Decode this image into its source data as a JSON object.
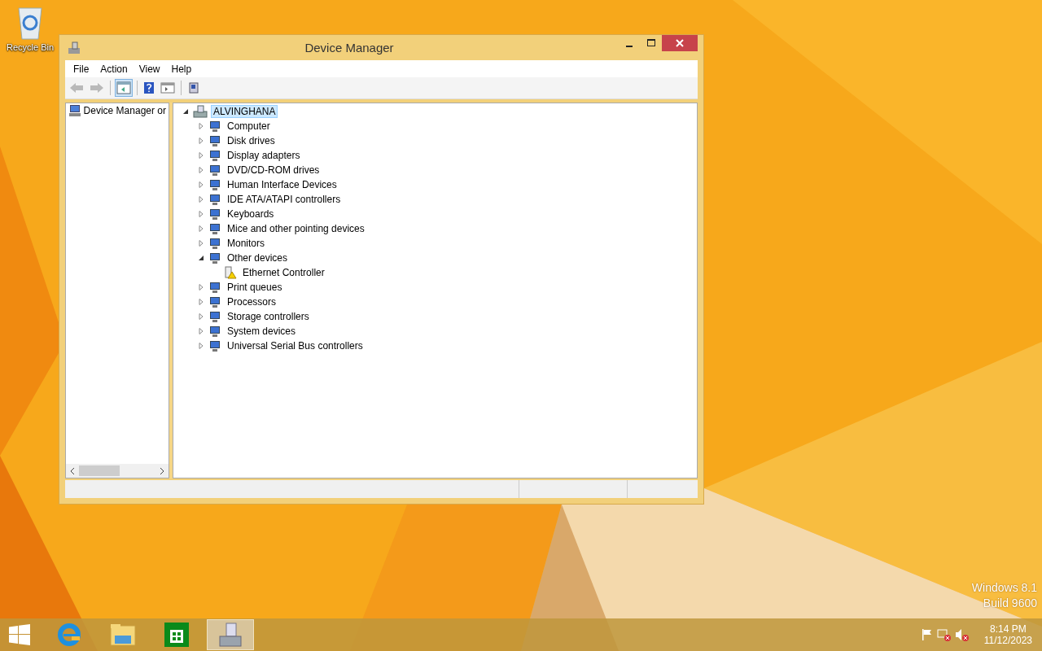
{
  "desktop": {
    "icons": [
      {
        "label": "Recycle Bin"
      }
    ],
    "watermark": [
      "Windows 8.1",
      "Build 9600"
    ]
  },
  "window": {
    "title": "Device Manager"
  },
  "menu": [
    "File",
    "Action",
    "View",
    "Help"
  ],
  "toolbar": [
    {
      "kind": "back",
      "disabled": true
    },
    {
      "kind": "forward",
      "disabled": true
    },
    {
      "kind": "sep"
    },
    {
      "kind": "tree",
      "selected": true
    },
    {
      "kind": "sep"
    },
    {
      "kind": "help",
      "selected": false
    },
    {
      "kind": "pane",
      "selected": false
    },
    {
      "kind": "sep"
    },
    {
      "kind": "scan",
      "selected": false
    }
  ],
  "left_pane": {
    "item": "Device Manager or"
  },
  "tree": {
    "label": "ALVINGHANA",
    "expanded": true,
    "selected": true,
    "children": [
      {
        "label": "Computer",
        "expanded": false
      },
      {
        "label": "Disk drives",
        "expanded": false
      },
      {
        "label": "Display adapters",
        "expanded": false
      },
      {
        "label": "DVD/CD-ROM drives",
        "expanded": false
      },
      {
        "label": "Human Interface Devices",
        "expanded": false
      },
      {
        "label": "IDE ATA/ATAPI controllers",
        "expanded": false
      },
      {
        "label": "Keyboards",
        "expanded": false
      },
      {
        "label": "Mice and other pointing devices",
        "expanded": false
      },
      {
        "label": "Monitors",
        "expanded": false
      },
      {
        "label": "Other devices",
        "expanded": true,
        "children": [
          {
            "label": "Ethernet Controller",
            "warning": true
          }
        ]
      },
      {
        "label": "Print queues",
        "expanded": false
      },
      {
        "label": "Processors",
        "expanded": false
      },
      {
        "label": "Storage controllers",
        "expanded": false
      },
      {
        "label": "System devices",
        "expanded": false
      },
      {
        "label": "Universal Serial Bus controllers",
        "expanded": false
      }
    ]
  },
  "taskbar": {
    "apps": [
      {
        "kind": "browser",
        "selected": false
      },
      {
        "kind": "folder",
        "selected": false
      },
      {
        "kind": "store",
        "selected": false
      },
      {
        "kind": "devmgr",
        "selected": true
      }
    ],
    "clock": {
      "time": "8:14 PM",
      "date": "11/12/2023"
    }
  }
}
